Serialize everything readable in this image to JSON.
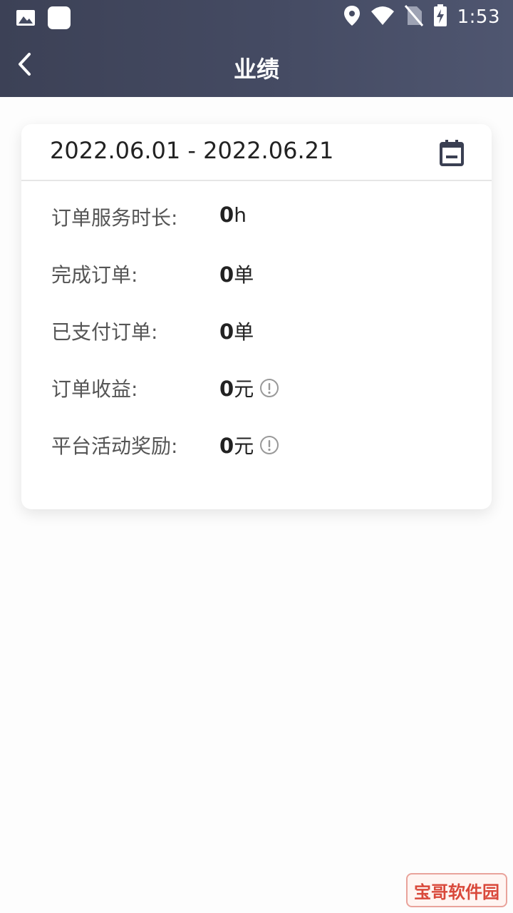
{
  "status_bar": {
    "time": "1:53",
    "left_icons": [
      "image-icon",
      "app-icon"
    ],
    "right_icons": [
      "location-icon",
      "wifi-icon",
      "no-sim-icon",
      "battery-charging-icon"
    ]
  },
  "nav": {
    "title": "业绩",
    "back_icon": "chevron-left-icon"
  },
  "card": {
    "date_range": "2022.06.01 - 2022.06.21",
    "calendar_icon": "calendar-icon",
    "rows": [
      {
        "label": "订单服务时长:",
        "value": "0",
        "unit": "h",
        "info": false
      },
      {
        "label": "完成订单:",
        "value": "0",
        "unit": "单",
        "info": false
      },
      {
        "label": "已支付订单:",
        "value": "0",
        "unit": "单",
        "info": false
      },
      {
        "label": "订单收益:",
        "value": "0",
        "unit": "元",
        "info": true
      },
      {
        "label": "平台活动奖励:",
        "value": "0",
        "unit": "元",
        "info": true
      }
    ]
  },
  "watermark": "宝哥软件园",
  "colors": {
    "header_start": "#3c4156",
    "header_end": "#4f5670",
    "text_primary": "#222222",
    "text_label": "#555555",
    "info_icon": "#999999"
  }
}
